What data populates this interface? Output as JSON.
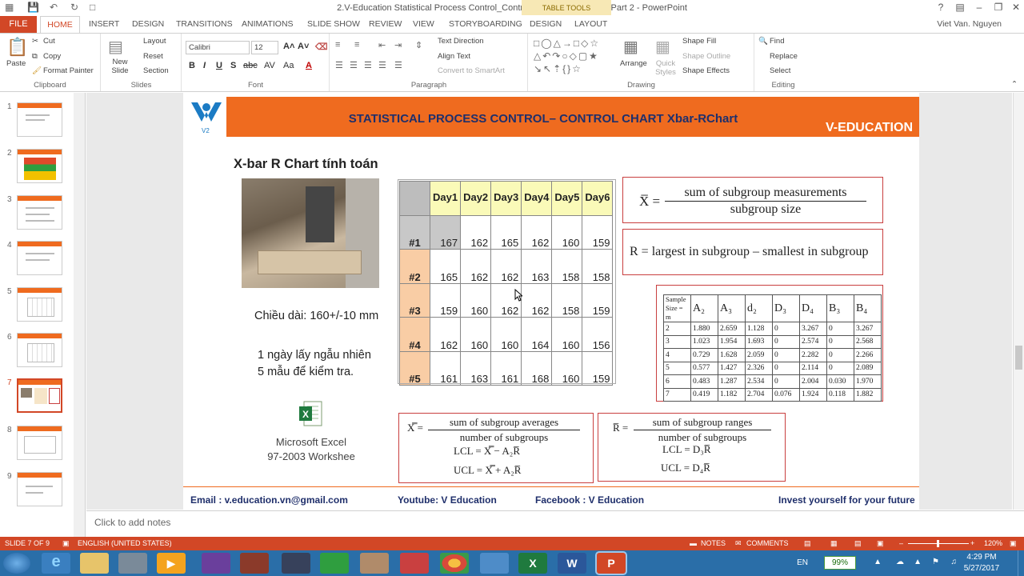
{
  "window": {
    "title": "2.V-Education Statistical Process Control_Control Chart Xbar-R Chart Part 2 - PowerPoint",
    "contextual_tab": "TABLE TOOLS",
    "user": "Viet Van. Nguyen"
  },
  "ribbon_tabs": [
    "FILE",
    "HOME",
    "INSERT",
    "DESIGN",
    "TRANSITIONS",
    "ANIMATIONS",
    "SLIDE SHOW",
    "REVIEW",
    "VIEW",
    "STORYBOARDING",
    "DESIGN",
    "LAYOUT"
  ],
  "ribbon": {
    "clipboard": {
      "label": "Clipboard",
      "paste": "Paste",
      "cut": "Cut",
      "copy": "Copy",
      "format_painter": "Format Painter"
    },
    "slides": {
      "label": "Slides",
      "new_slide": "New Slide",
      "layout": "Layout",
      "reset": "Reset",
      "section": "Section"
    },
    "font": {
      "label": "Font",
      "font_name": "Calibri",
      "font_size": "12"
    },
    "paragraph": {
      "label": "Paragraph",
      "text_direction": "Text Direction",
      "align_text": "Align Text",
      "smartart": "Convert to SmartArt"
    },
    "drawing": {
      "label": "Drawing",
      "arrange": "Arrange",
      "quick_styles": "Quick Styles",
      "shape_fill": "Shape Fill",
      "shape_outline": "Shape Outline",
      "shape_effects": "Shape Effects"
    },
    "editing": {
      "label": "Editing",
      "find": "Find",
      "replace": "Replace",
      "select": "Select"
    }
  },
  "slides_pane": {
    "numbers": [
      "1",
      "2",
      "3",
      "4",
      "5",
      "6",
      "7",
      "8",
      "9"
    ],
    "selected": 7
  },
  "slide": {
    "header_title": "STATISTICAL PROCESS CONTROL– CONTROL CHART Xbar-RChart",
    "brand": "V-EDUCATION",
    "logo_text": "V2",
    "subtitle": "X-bar R Chart tính toán",
    "length_text": "Chiều dài: 160+/-10 mm",
    "sampling_line1": "1 ngày lấy ngẫu nhiên",
    "sampling_line2": "5 mẫu để kiểm tra.",
    "excel_caption_line1": "Microsoft Excel",
    "excel_caption_line2": "97-2003 Workshee",
    "data_table": {
      "columns": [
        "Day1",
        "Day2",
        "Day3",
        "Day4",
        "Day5",
        "Day6"
      ],
      "rows": [
        {
          "label": "#1",
          "values": [
            "167",
            "162",
            "165",
            "162",
            "160",
            "159"
          ]
        },
        {
          "label": "#2",
          "values": [
            "165",
            "162",
            "162",
            "163",
            "158",
            "158"
          ]
        },
        {
          "label": "#3",
          "values": [
            "159",
            "160",
            "162",
            "162",
            "158",
            "159"
          ]
        },
        {
          "label": "#4",
          "values": [
            "162",
            "160",
            "160",
            "164",
            "160",
            "156"
          ]
        },
        {
          "label": "#5",
          "values": [
            "161",
            "163",
            "161",
            "168",
            "160",
            "159"
          ]
        }
      ]
    },
    "formula_xbar": {
      "lhs": "X̅ =",
      "num": "sum of subgroup measurements",
      "den": "subgroup size"
    },
    "formula_r": "R = largest in subgroup – smallest in subgroup",
    "constants_table": {
      "headers": [
        "Sample Size = m",
        "A₂",
        "A₃",
        "d₂",
        "D₃",
        "D₄",
        "B₃",
        "B₄"
      ],
      "rows": [
        [
          "2",
          "1.880",
          "2.659",
          "1.128",
          "0",
          "3.267",
          "0",
          "3.267"
        ],
        [
          "3",
          "1.023",
          "1.954",
          "1.693",
          "0",
          "2.574",
          "0",
          "2.568"
        ],
        [
          "4",
          "0.729",
          "1.628",
          "2.059",
          "0",
          "2.282",
          "0",
          "2.266"
        ],
        [
          "5",
          "0.577",
          "1.427",
          "2.326",
          "0",
          "2.114",
          "0",
          "2.089"
        ],
        [
          "6",
          "0.483",
          "1.287",
          "2.534",
          "0",
          "2.004",
          "0.030",
          "1.970"
        ],
        [
          "7",
          "0.419",
          "1.182",
          "2.704",
          "0.076",
          "1.924",
          "0.118",
          "1.882"
        ]
      ]
    },
    "formula_xbarbar": {
      "lhs": "X̿ =",
      "num": "sum of subgroup averages",
      "den": "number of  subgroups",
      "lcl": "LCL = X̿ − A₂R̅",
      "ucl": "UCL = X̿ + A₂R̅"
    },
    "formula_rbar": {
      "lhs": "R̅ =",
      "num": "sum of subgroup ranges",
      "den": "number of  subgroups",
      "lcl": "LCL = D₃R̅",
      "ucl": "UCL = D₄R̅"
    },
    "footer": {
      "email": "Email : v.education.vn@gmail.com",
      "youtube": "Youtube: V Education",
      "facebook": "Facebook : V Education",
      "tagline": "Invest yourself for your future"
    }
  },
  "notes_placeholder": "Click to add notes",
  "status": {
    "slide": "SLIDE 7 OF 9",
    "language": "ENGLISH (UNITED STATES)",
    "notes": "NOTES",
    "comments": "COMMENTS",
    "zoom": "120%"
  },
  "taskbar": {
    "lang": "EN",
    "battery": "99%",
    "time": "4:29 PM",
    "date": "5/27/2017"
  },
  "colors": {
    "accent": "#d24726",
    "header_orange": "#ef6b1f",
    "navy": "#1f2f6b",
    "taskbar": "#2a6ea8"
  }
}
